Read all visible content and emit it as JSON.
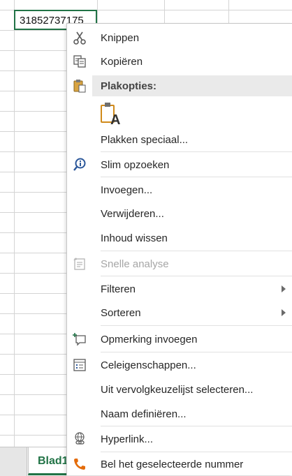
{
  "cell": {
    "value": "31852737175"
  },
  "sheet_tab": {
    "label": "Blad1",
    "accent": "#217346"
  },
  "menu": {
    "items": [
      {
        "id": "cut",
        "label": "Knippen",
        "icon": "scissors-icon"
      },
      {
        "id": "copy",
        "label": "Kopiëren",
        "icon": "copy-icon"
      },
      {
        "id": "paste_section",
        "label": "Plakopties:",
        "icon": "clipboard-icon"
      },
      {
        "id": "paste_values",
        "icon": "paste-values-icon",
        "glyph": "A"
      },
      {
        "id": "paste_special",
        "label": "Plakken speciaal..."
      },
      {
        "id": "smart_lookup",
        "label": "Slim opzoeken",
        "icon": "smart-lookup-icon"
      },
      {
        "id": "insert",
        "label": "Invoegen..."
      },
      {
        "id": "delete",
        "label": "Verwijderen..."
      },
      {
        "id": "clear",
        "label": "Inhoud wissen"
      },
      {
        "id": "quick_analysis",
        "label": "Snelle analyse",
        "icon": "quick-analysis-icon",
        "disabled": true
      },
      {
        "id": "filter",
        "label": "Filteren",
        "submenu": true
      },
      {
        "id": "sort",
        "label": "Sorteren",
        "submenu": true
      },
      {
        "id": "comment",
        "label": "Opmerking invoegen",
        "icon": "comment-icon"
      },
      {
        "id": "format_cells",
        "label": "Celeigenschappen...",
        "icon": "format-cells-icon"
      },
      {
        "id": "pick_list",
        "label": "Uit vervolgkeuzelijst selecteren..."
      },
      {
        "id": "define_name",
        "label": "Naam definiëren..."
      },
      {
        "id": "hyperlink",
        "label": "Hyperlink...",
        "icon": "hyperlink-icon"
      },
      {
        "id": "call",
        "label": "Bel het geselecteerde nummer",
        "icon": "phone-icon"
      }
    ]
  }
}
